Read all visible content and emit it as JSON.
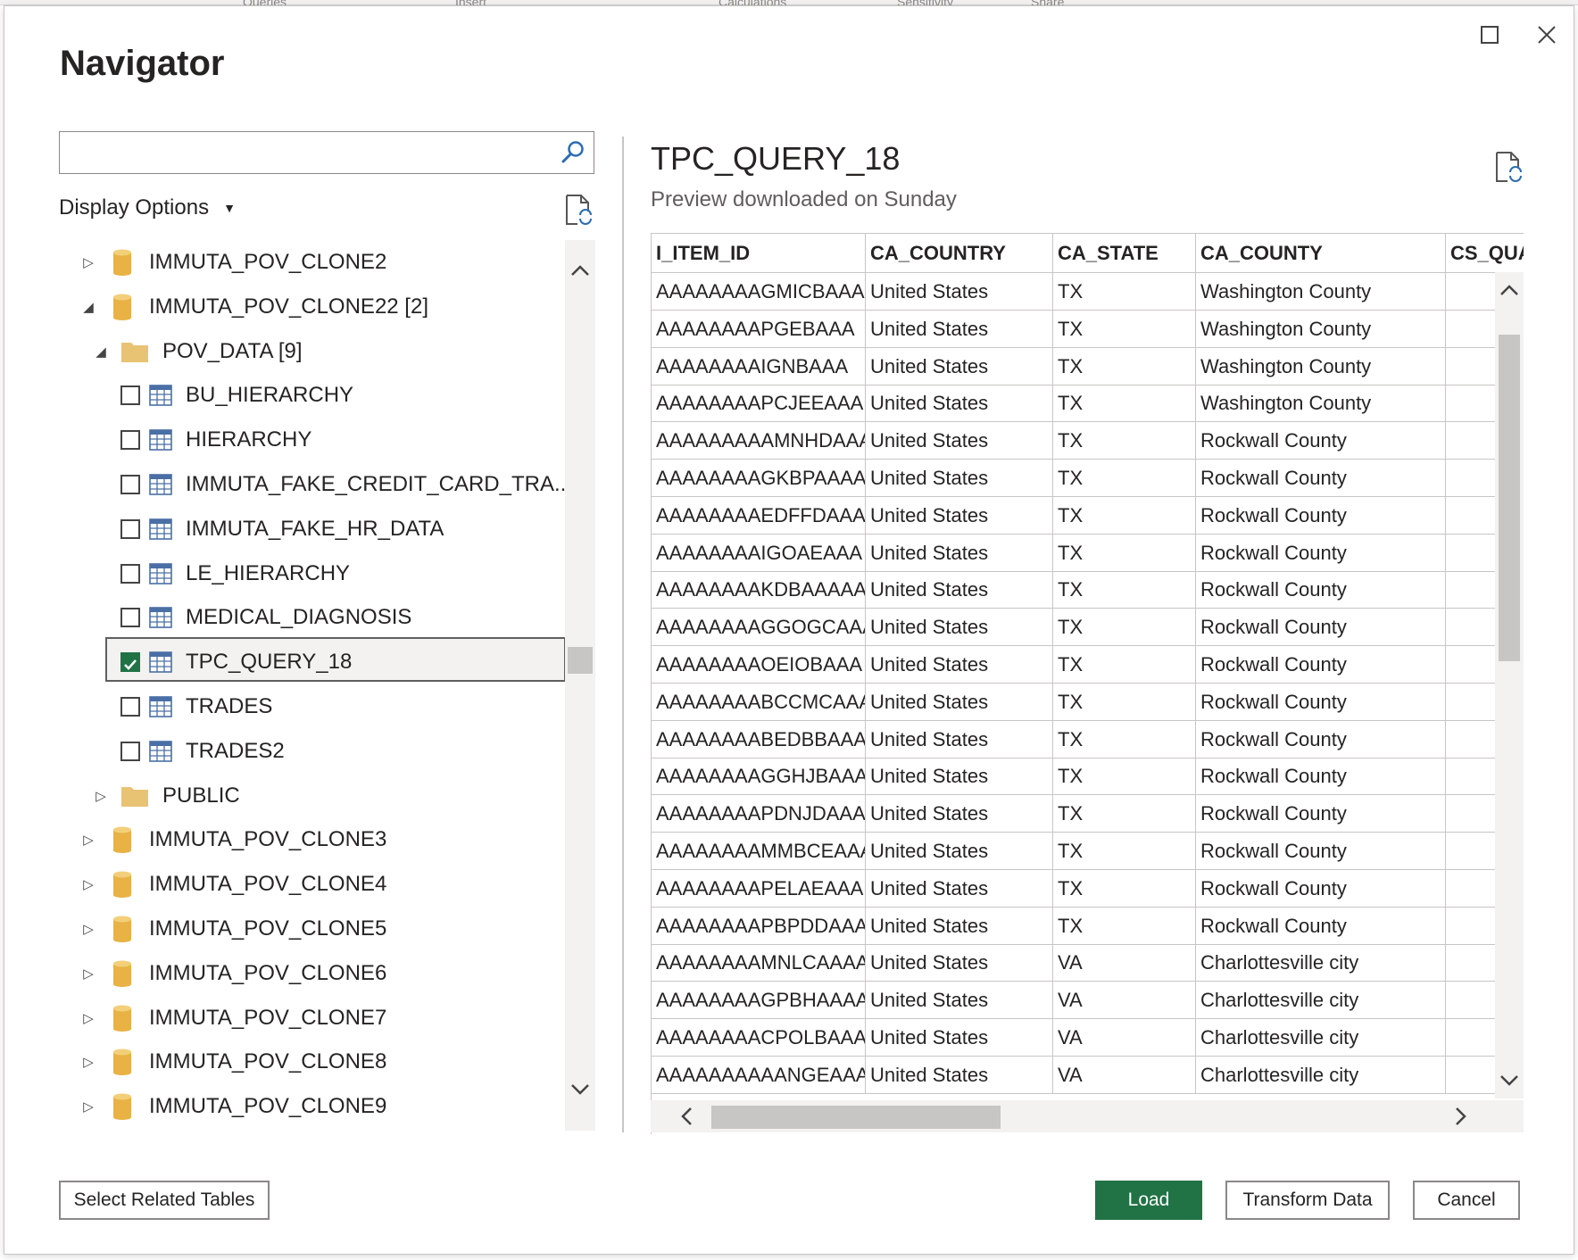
{
  "background_tabs": [
    "Queries",
    "Insert",
    "Calculations",
    "Sensitivity",
    "Share"
  ],
  "dialog": {
    "title": "Navigator",
    "maximize_icon": "maximize-icon",
    "close_icon": "close-icon"
  },
  "left": {
    "search": {
      "value": "",
      "placeholder": ""
    },
    "display_options_label": "Display Options",
    "tree": [
      {
        "label": "IMMUTA_POV_CLONE2",
        "kind": "database",
        "expanded": false
      },
      {
        "label": "IMMUTA_POV_CLONE22 [2]",
        "kind": "database",
        "expanded": true
      },
      {
        "label": "POV_DATA [9]",
        "kind": "folder",
        "expanded": true
      },
      {
        "label": "BU_HIERARCHY",
        "kind": "table",
        "checked": false
      },
      {
        "label": "HIERARCHY",
        "kind": "table",
        "checked": false
      },
      {
        "label": "IMMUTA_FAKE_CREDIT_CARD_TRA...",
        "kind": "table",
        "checked": false
      },
      {
        "label": "IMMUTA_FAKE_HR_DATA",
        "kind": "table",
        "checked": false
      },
      {
        "label": "LE_HIERARCHY",
        "kind": "table",
        "checked": false
      },
      {
        "label": "MEDICAL_DIAGNOSIS",
        "kind": "table",
        "checked": false
      },
      {
        "label": "TPC_QUERY_18",
        "kind": "table",
        "checked": true,
        "selected": true
      },
      {
        "label": "TRADES",
        "kind": "table",
        "checked": false
      },
      {
        "label": "TRADES2",
        "kind": "table",
        "checked": false
      },
      {
        "label": "PUBLIC",
        "kind": "folder",
        "expanded": false
      },
      {
        "label": "IMMUTA_POV_CLONE3",
        "kind": "database",
        "expanded": false
      },
      {
        "label": "IMMUTA_POV_CLONE4",
        "kind": "database",
        "expanded": false
      },
      {
        "label": "IMMUTA_POV_CLONE5",
        "kind": "database",
        "expanded": false
      },
      {
        "label": "IMMUTA_POV_CLONE6",
        "kind": "database",
        "expanded": false
      },
      {
        "label": "IMMUTA_POV_CLONE7",
        "kind": "database",
        "expanded": false
      },
      {
        "label": "IMMUTA_POV_CLONE8",
        "kind": "database",
        "expanded": false
      },
      {
        "label": "IMMUTA_POV_CLONE9",
        "kind": "database",
        "expanded": false
      }
    ]
  },
  "preview": {
    "title": "TPC_QUERY_18",
    "subtitle": "Preview downloaded on Sunday",
    "columns": [
      "I_ITEM_ID",
      "CA_COUNTRY",
      "CA_STATE",
      "CA_COUNTY",
      "CS_QUA"
    ],
    "rows": [
      [
        "AAAAAAAAGMICBAAA",
        "United States",
        "TX",
        "Washington County",
        ""
      ],
      [
        "AAAAAAAAPGEBAAA",
        "United States",
        "TX",
        "Washington County",
        ""
      ],
      [
        "AAAAAAAAIGNBAAA",
        "United States",
        "TX",
        "Washington County",
        ""
      ],
      [
        "AAAAAAAAPCJEEAAA",
        "United States",
        "TX",
        "Washington County",
        ""
      ],
      [
        "AAAAAAAAAMNHDAAA",
        "United States",
        "TX",
        "Rockwall County",
        ""
      ],
      [
        "AAAAAAAAGKBPAAAA",
        "United States",
        "TX",
        "Rockwall County",
        ""
      ],
      [
        "AAAAAAAAEDFFDAAA",
        "United States",
        "TX",
        "Rockwall County",
        ""
      ],
      [
        "AAAAAAAAIGOAEAAA",
        "United States",
        "TX",
        "Rockwall County",
        ""
      ],
      [
        "AAAAAAAAKDBAAAAA",
        "United States",
        "TX",
        "Rockwall County",
        ""
      ],
      [
        "AAAAAAAAGGOGCAAA",
        "United States",
        "TX",
        "Rockwall County",
        ""
      ],
      [
        "AAAAAAAAOEIOBAAA",
        "United States",
        "TX",
        "Rockwall County",
        ""
      ],
      [
        "AAAAAAAABCCMCAAA",
        "United States",
        "TX",
        "Rockwall County",
        ""
      ],
      [
        "AAAAAAAABEDBBAAA",
        "United States",
        "TX",
        "Rockwall County",
        ""
      ],
      [
        "AAAAAAAAGGHJBAAA",
        "United States",
        "TX",
        "Rockwall County",
        ""
      ],
      [
        "AAAAAAAAPDNJDAAA",
        "United States",
        "TX",
        "Rockwall County",
        ""
      ],
      [
        "AAAAAAAAMMBCEAAA",
        "United States",
        "TX",
        "Rockwall County",
        ""
      ],
      [
        "AAAAAAAAPELAEAAA",
        "United States",
        "TX",
        "Rockwall County",
        ""
      ],
      [
        "AAAAAAAAPBPDDAAA",
        "United States",
        "TX",
        "Rockwall County",
        ""
      ],
      [
        "AAAAAAAAMNLCAAAA",
        "United States",
        "VA",
        "Charlottesville city",
        ""
      ],
      [
        "AAAAAAAAGPBHAAAA",
        "United States",
        "VA",
        "Charlottesville city",
        ""
      ],
      [
        "AAAAAAAACPOLBAAA",
        "United States",
        "VA",
        "Charlottesville city",
        ""
      ],
      [
        "AAAAAAAAAANGEAAA",
        "United States",
        "VA",
        "Charlottesville city",
        ""
      ]
    ]
  },
  "footer": {
    "select_related_label": "Select Related Tables",
    "load_label": "Load",
    "transform_label": "Transform Data",
    "cancel_label": "Cancel"
  },
  "colors": {
    "accent": "#217346",
    "db_icon": "#e8b245",
    "folder_icon": "#e8c374",
    "table_icon": "#4a6fa5"
  }
}
